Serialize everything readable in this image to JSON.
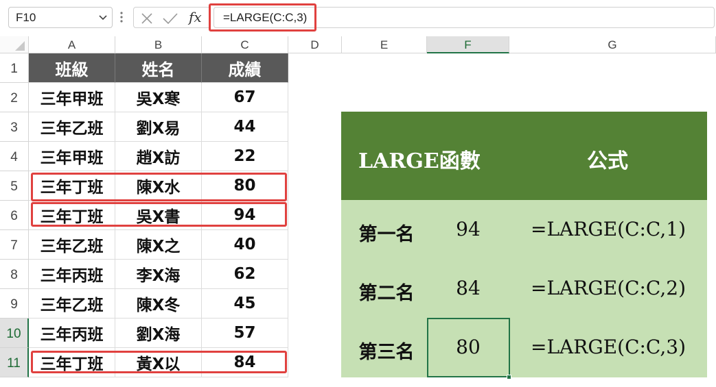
{
  "formula_bar": {
    "name_box": "F10",
    "formula": "=LARGE(C:C,3)",
    "fx_label": "fx"
  },
  "columns": [
    "A",
    "B",
    "C",
    "D",
    "E",
    "F",
    "G"
  ],
  "rows": [
    "1",
    "2",
    "3",
    "4",
    "5",
    "6",
    "7",
    "8",
    "9",
    "10",
    "11"
  ],
  "table": {
    "headers": [
      "班級",
      "姓名",
      "成績"
    ],
    "data": [
      [
        "三年甲班",
        "吳X寒",
        "67"
      ],
      [
        "三年乙班",
        "劉X易",
        "44"
      ],
      [
        "三年甲班",
        "趙X訪",
        "22"
      ],
      [
        "三年丁班",
        "陳X水",
        "80"
      ],
      [
        "三年丁班",
        "吳X書",
        "94"
      ],
      [
        "三年乙班",
        "陳X之",
        "40"
      ],
      [
        "三年丙班",
        "李X海",
        "62"
      ],
      [
        "三年乙班",
        "陳X冬",
        "45"
      ],
      [
        "三年丙班",
        "劉X海",
        "57"
      ],
      [
        "三年丁班",
        "黃X以",
        "84"
      ]
    ]
  },
  "results": {
    "header_func": "LARGE函數",
    "header_formula": "公式",
    "rows": [
      {
        "rank": "第一名",
        "value": "94",
        "formula": "=LARGE(C:C,1)"
      },
      {
        "rank": "第二名",
        "value": "84",
        "formula": "=LARGE(C:C,2)"
      },
      {
        "rank": "第三名",
        "value": "80",
        "formula": "=LARGE(C:C,3)"
      }
    ]
  },
  "colors": {
    "accent_green": "#217346",
    "highlight_red": "#e0413f",
    "header_gray": "#595959",
    "table_head_green": "#548235",
    "table_body_green": "#c6e0b4"
  }
}
